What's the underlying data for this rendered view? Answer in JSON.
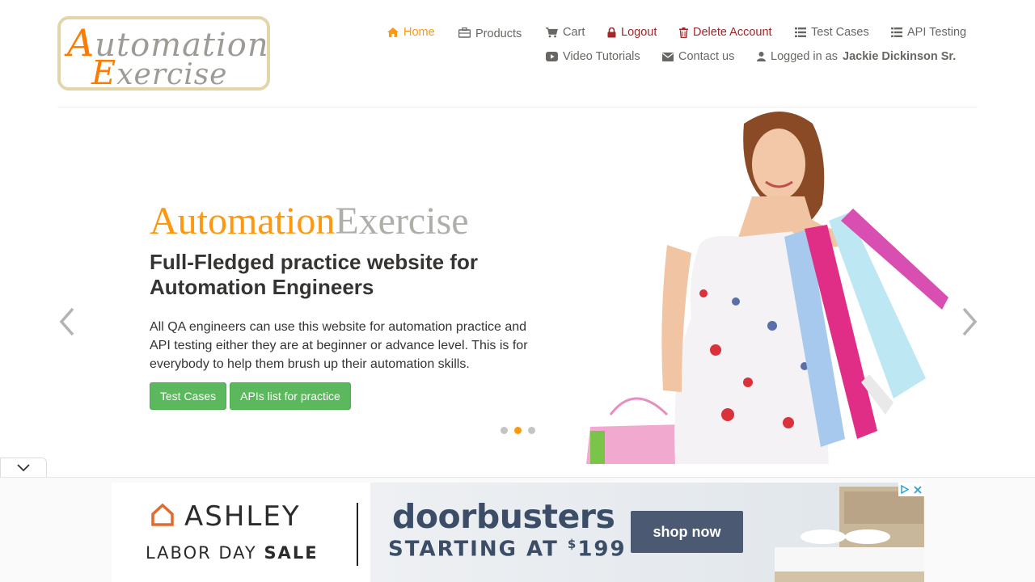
{
  "header": {
    "logo": {
      "line1": "Automation",
      "line2": "Exercise"
    },
    "nav": {
      "home": "Home",
      "products": "Products",
      "cart": "Cart",
      "logout": "Logout",
      "delete_account": "Delete Account",
      "test_cases": "Test Cases",
      "api_testing": "API Testing",
      "video_tutorials": "Video Tutorials",
      "contact_us": "Contact us",
      "logged_in_prefix": "Logged in as",
      "logged_in_user": "Jackie Dickinson Sr."
    }
  },
  "slider": {
    "brand_part1": "Automation",
    "brand_part2": "Exercise",
    "headline": "Full-Fledged practice website for Automation Engineers",
    "description": "All QA engineers can use this website for automation practice and API testing either they are at beginner or advance level. This is for everybody to help them brush up their automation skills.",
    "btn_test_cases": "Test Cases",
    "btn_apis": "APIs list for practice",
    "dots": 3,
    "active_dot": 2
  },
  "ad": {
    "brand": "ASHLEY",
    "event_prefix": "LABOR DAY",
    "event_bold": "SALE",
    "headline": "doorbusters",
    "starting": "STARTING AT",
    "price_symbol": "$",
    "price": "199",
    "cta": "shop now"
  },
  "colors": {
    "accent": "#fe980f",
    "danger": "#a1262a",
    "button_green": "#5cb85c",
    "text": "#696763"
  }
}
